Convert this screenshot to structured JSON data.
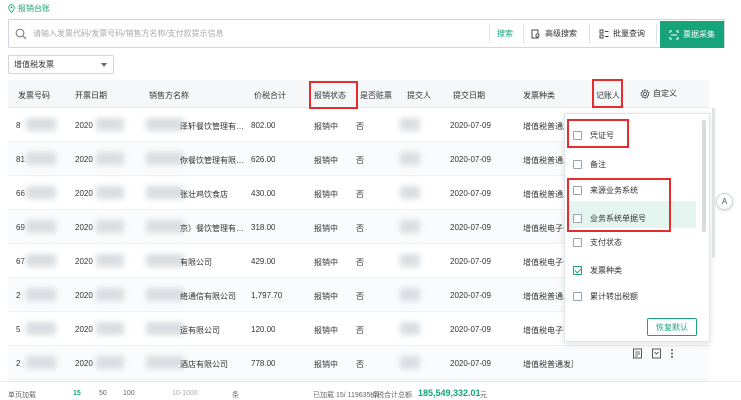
{
  "breadcrumb": {
    "label": "报销台账"
  },
  "search": {
    "placeholder": "请输入发票代码/发票号码/销售方名称/支付款提示信息",
    "search_btn": "搜索",
    "advanced_btn": "高级搜索",
    "batch_btn": "批量查询",
    "collect_btn": "票据采集"
  },
  "filter": {
    "invoice_type": "增值税发票"
  },
  "columns": {
    "code": "发票号码",
    "date": "开票日期",
    "seller": "销售方名称",
    "total": "价税合计",
    "status": "报销状态",
    "void": "是否赃票",
    "submitter": "提交人",
    "submit_date": "提交日期",
    "kind": "发票种类",
    "bookkeeper": "记账人",
    "custom": "自定义"
  },
  "rows": [
    {
      "code": "8",
      "date": "2020",
      "seller": "泽轩餐饮管理有…",
      "total": "802.00",
      "status": "报销中",
      "void": "否",
      "submit_date": "2020-07-09",
      "kind": "增值税普通发"
    },
    {
      "code": "81",
      "date": "2020",
      "seller": "你餐饮管理有限…",
      "total": "626.00",
      "status": "报销中",
      "void": "否",
      "submit_date": "2020-07-09",
      "kind": "增值税普通发"
    },
    {
      "code": "66",
      "date": "2020",
      "seller": "张壮鸡饮食店",
      "total": "430.00",
      "status": "报销中",
      "void": "否",
      "submit_date": "2020-07-09",
      "kind": "增值税普通发"
    },
    {
      "code": "69",
      "date": "2020",
      "seller": "京）餐饮管理有…",
      "total": "318.00",
      "status": "报销中",
      "void": "否",
      "submit_date": "2020-07-09",
      "kind": "增值税电子普"
    },
    {
      "code": "67",
      "date": "2020",
      "seller": "有限公司",
      "total": "429.00",
      "status": "报销中",
      "void": "否",
      "submit_date": "2020-07-09",
      "kind": "增值税电子普"
    },
    {
      "code": "2",
      "date": "2020",
      "seller": "络通信有限公司",
      "total": "1,797.70",
      "status": "报销中",
      "void": "否",
      "submit_date": "2020-07-09",
      "kind": "增值税普通发"
    },
    {
      "code": "5",
      "date": "2020",
      "seller": "运有限公司",
      "total": "120.00",
      "status": "报销中",
      "void": "否",
      "submit_date": "2020-07-09",
      "kind": "增值税电子普"
    },
    {
      "code": "2",
      "date": "2020",
      "seller": "酒店有限公司",
      "total": "778.00",
      "status": "报销中",
      "void": "否",
      "submit_date": "2020-07-09",
      "kind": "增值税普通发票"
    }
  ],
  "dropdown": {
    "items": [
      {
        "label": "凭证号",
        "checked": false
      },
      {
        "label": "备注",
        "checked": false
      },
      {
        "label": "来源业务系统",
        "checked": false
      },
      {
        "label": "业务系统单据号",
        "checked": false
      },
      {
        "label": "支付状态",
        "checked": false
      },
      {
        "label": "发票种类",
        "checked": true
      },
      {
        "label": "累计转出税额",
        "checked": false
      }
    ],
    "reset": "恢复默认"
  },
  "footer": {
    "per_page_label": "单页加载",
    "sizes": [
      "15",
      "50",
      "100"
    ],
    "range": "10-1000",
    "unit": "条",
    "loaded": "已加载 15/ 119635 条",
    "amount_label": "价税合计总额",
    "amount": "185,549,332.01",
    "amount_unit": "元"
  },
  "float_btn": "A",
  "colors": {
    "accent": "#17a47b",
    "highlight": "#e52d2d"
  }
}
